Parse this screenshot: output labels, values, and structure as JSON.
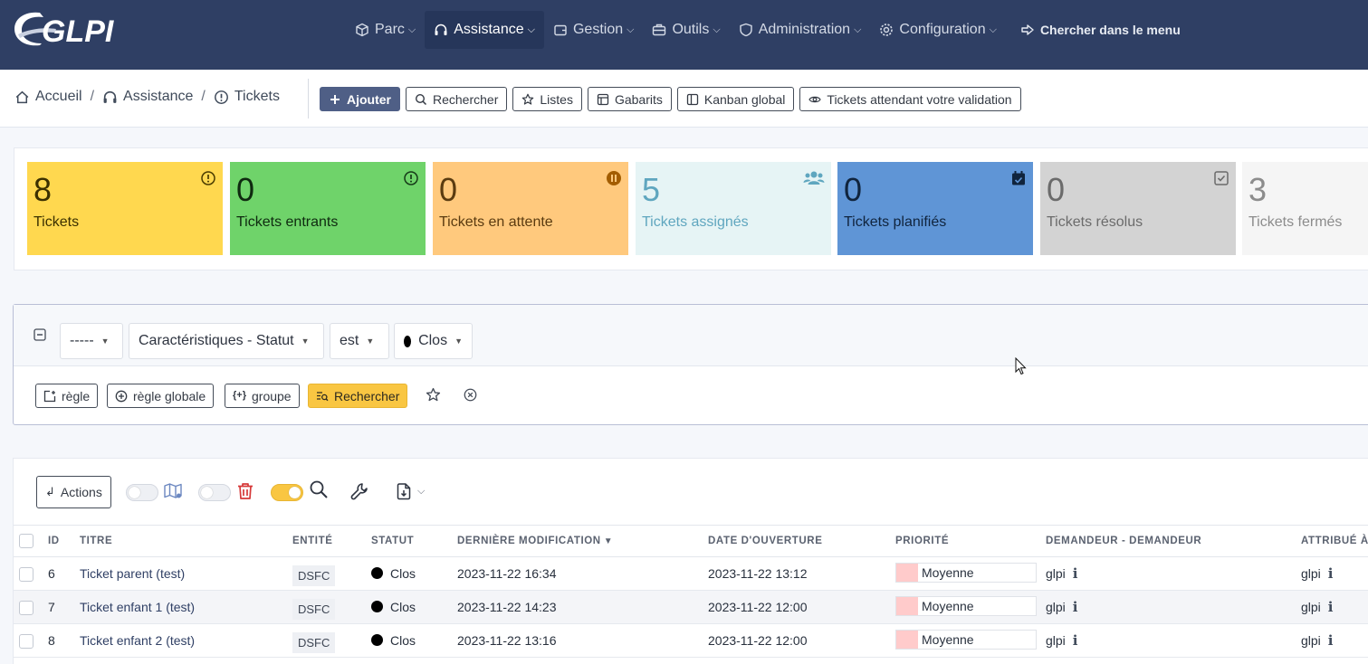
{
  "app": {
    "logo_text": "GLPI"
  },
  "nav": {
    "items": [
      {
        "label": "Parc",
        "icon": "cube-icon"
      },
      {
        "label": "Assistance",
        "icon": "headset-icon",
        "active": true
      },
      {
        "label": "Gestion",
        "icon": "wallet-icon"
      },
      {
        "label": "Outils",
        "icon": "briefcase-icon"
      },
      {
        "label": "Administration",
        "icon": "shield-icon"
      },
      {
        "label": "Configuration",
        "icon": "gear-icon"
      }
    ],
    "search_label": "Chercher dans le menu"
  },
  "breadcrumb": {
    "home": "Accueil",
    "section": "Assistance",
    "page": "Tickets"
  },
  "toolbar": {
    "add": "Ajouter",
    "search": "Rechercher",
    "lists": "Listes",
    "templates": "Gabarits",
    "kanban": "Kanban global",
    "validation": "Tickets attendant votre validation"
  },
  "stats": [
    {
      "value": "8",
      "label": "Tickets",
      "bg": "#ffd84f",
      "fg": "#3b3000"
    },
    {
      "value": "0",
      "label": "Tickets entrants",
      "bg": "#6fd36a",
      "fg": "#0f2a10"
    },
    {
      "value": "0",
      "label": "Tickets en attente",
      "bg": "#ffc97d",
      "fg": "#5a3b10"
    },
    {
      "value": "5",
      "label": "Tickets assignés",
      "bg": "#e6f4f5",
      "fg": "#5fa6bf"
    },
    {
      "value": "0",
      "label": "Tickets planifiés",
      "bg": "#5f95d6",
      "fg": "#10243d"
    },
    {
      "value": "0",
      "label": "Tickets résolus",
      "bg": "#d3d3d3",
      "fg": "#6b6b6b"
    },
    {
      "value": "3",
      "label": "Tickets fermés",
      "bg": "#f5f5f5",
      "fg": "#8c8c8c"
    }
  ],
  "criteria": {
    "link": "-----",
    "field": "Caractéristiques - Statut",
    "operator": "est",
    "value": "Clos",
    "btn_rule": "règle",
    "btn_global_rule": "règle globale",
    "btn_group": "groupe",
    "btn_search": "Rechercher"
  },
  "results": {
    "actions_label": "Actions",
    "columns": [
      "ID",
      "TITRE",
      "ENTITÉ",
      "STATUT",
      "DERNIÈRE MODIFICATION",
      "DATE D'OUVERTURE",
      "PRIORITÉ",
      "DEMANDEUR - DEMANDEUR",
      "ATTRIBUÉ À"
    ],
    "rows": [
      {
        "id": "6",
        "title": "Ticket parent (test)",
        "entity": "DSFC",
        "status": "Clos",
        "modified": "2023-11-22 16:34",
        "opened": "2023-11-22 13:12",
        "priority": "Moyenne",
        "requester": "glpi",
        "assigned": "glpi"
      },
      {
        "id": "7",
        "title": "Ticket enfant 1 (test)",
        "entity": "DSFC",
        "status": "Clos",
        "modified": "2023-11-22 14:23",
        "opened": "2023-11-22 12:00",
        "priority": "Moyenne",
        "requester": "glpi",
        "assigned": "glpi"
      },
      {
        "id": "8",
        "title": "Ticket enfant 2 (test)",
        "entity": "DSFC",
        "status": "Clos",
        "modified": "2023-11-22 13:16",
        "opened": "2023-11-22 12:00",
        "priority": "Moyenne",
        "requester": "glpi",
        "assigned": "glpi"
      }
    ]
  },
  "colors": {
    "navbar": "#2f3f64",
    "primary_button": "#4f5f86",
    "warning": "#f9c642",
    "priority_swatch": "#ffcbcb"
  }
}
